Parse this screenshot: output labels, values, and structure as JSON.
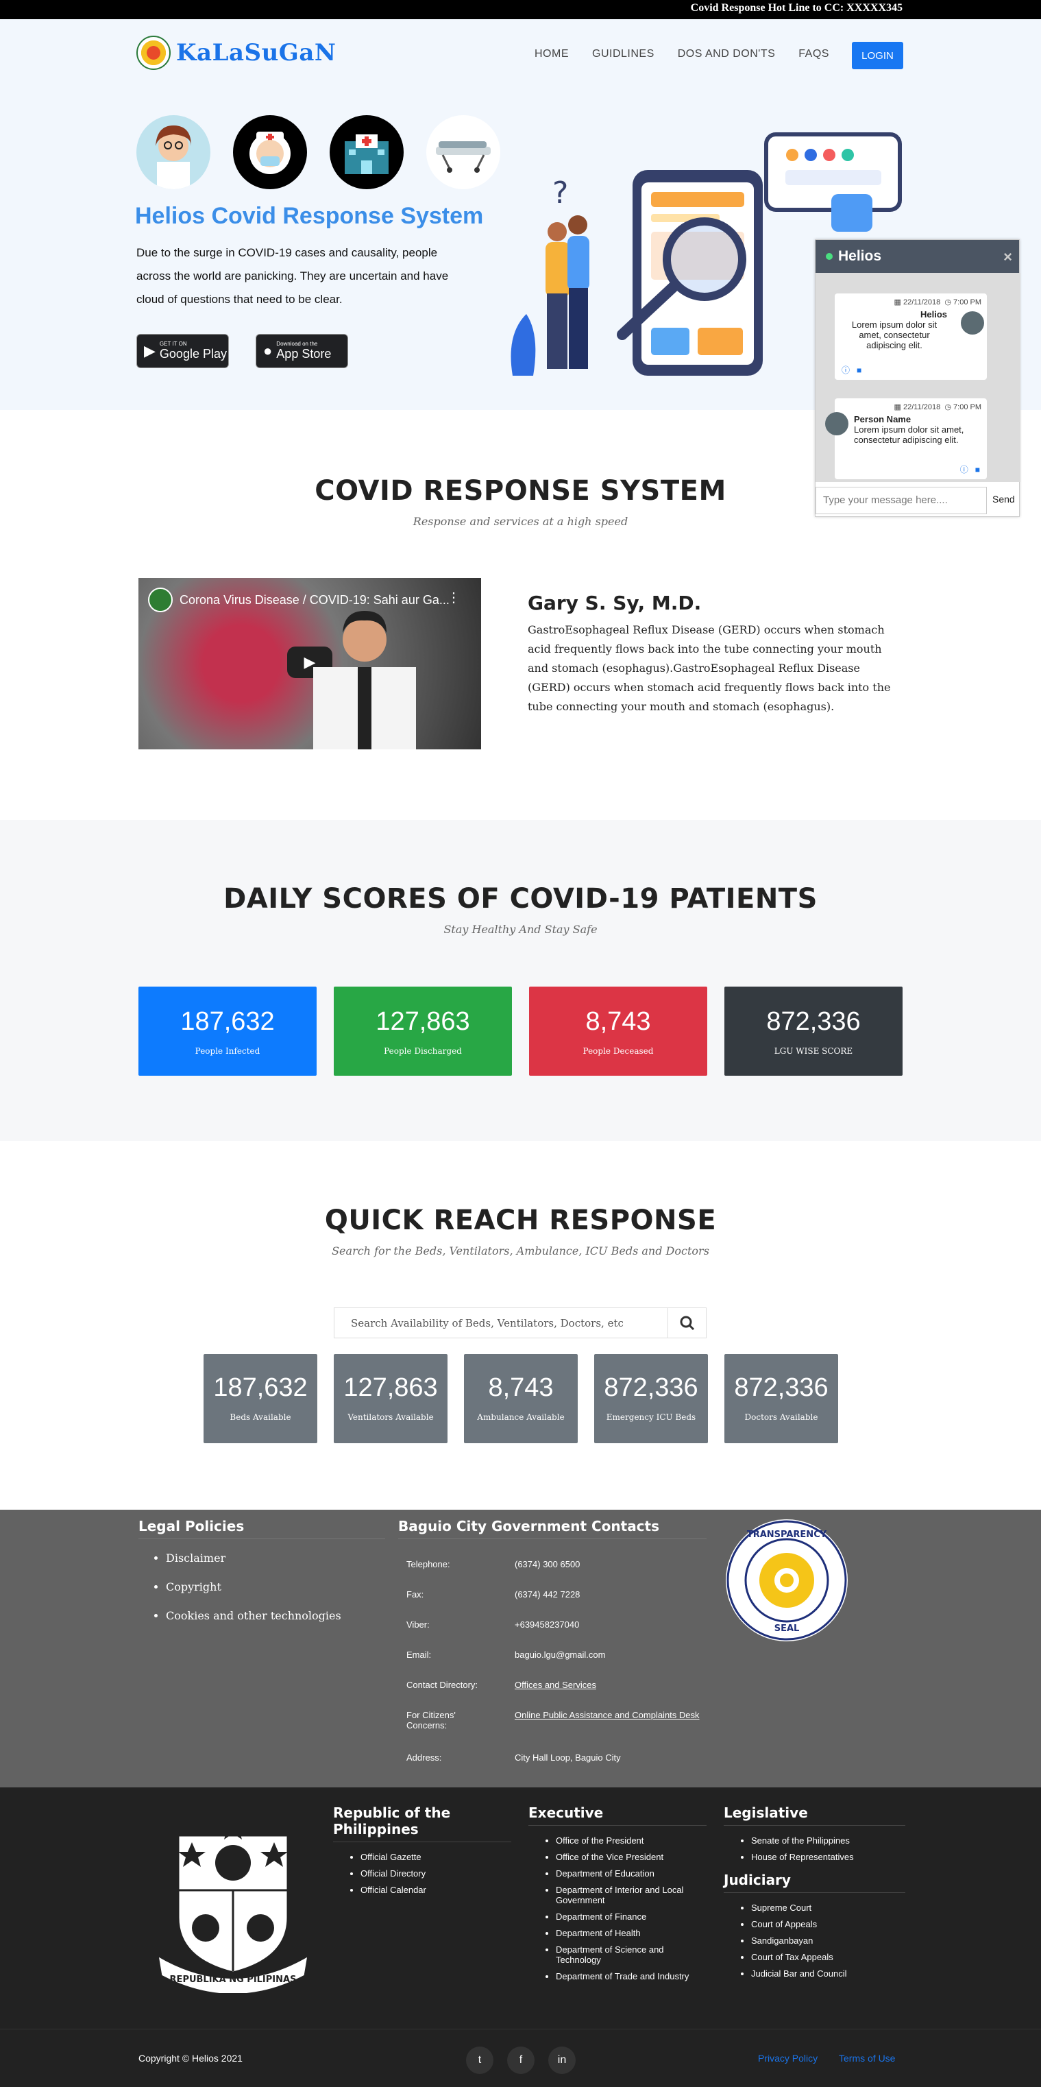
{
  "topbar": {
    "hotline": "Covid Response Hot Line to CC: XXXXX345"
  },
  "brand": {
    "name": "KaLaSuGaN"
  },
  "nav": {
    "items": [
      "HOME",
      "GUIDLINES",
      "DOS AND DON'TS",
      "FAQS"
    ],
    "login": "LOGIN"
  },
  "hero": {
    "title": "Helios Covid Response System",
    "description": "Due to the surge in COVID-19 cases and causality, people across the world are panicking. They are uncertain and have cloud of questions that need to be clear.",
    "google_small": "GET IT ON",
    "google_big": "Google Play",
    "apple_small": "Download on the",
    "apple_big": "App Store"
  },
  "chat": {
    "title": "Helios",
    "msg1": {
      "date": "22/11/2018",
      "time": "7:00 PM",
      "name": "Helios",
      "text": "Lorem ipsum dolor sit amet, consectetur adipiscing elit."
    },
    "msg2": {
      "date": "22/11/2018",
      "time": "7:00 PM",
      "name": "Person Name",
      "text": "Lorem ipsum dolor sit amet, consectetur adipiscing elit."
    },
    "placeholder": "Type your message here....",
    "send": "Send"
  },
  "covid_section": {
    "title": "COVID RESPONSE SYSTEM",
    "subtitle": "Response and services at a high speed",
    "video_title": "Corona Virus Disease / COVID-19: Sahi aur Ga...",
    "doctor_name": "Gary S. Sy, M.D.",
    "doctor_text": "GastroEsophageal Reflux Disease (GERD) occurs when stomach acid frequently flows back into the tube connecting your mouth and stomach (esophagus).GastroEsophageal Reflux Disease (GERD) occurs when stomach acid frequently flows back into the tube connecting your mouth and stomach (esophagus)."
  },
  "scores": {
    "title": "DAILY SCORES OF COVID-19 PATIENTS",
    "subtitle": "Stay Healthy And Stay Safe",
    "cards": [
      {
        "value": "187,632",
        "label": "People Infected",
        "color": "#0d7bfe"
      },
      {
        "value": "127,863",
        "label": "People Discharged",
        "color": "#28a745"
      },
      {
        "value": "8,743",
        "label": "People Deceased",
        "color": "#dc3545"
      },
      {
        "value": "872,336",
        "label": "LGU WISE SCORE",
        "color": "#343a40"
      }
    ]
  },
  "quick": {
    "title": "QUICK REACH RESPONSE",
    "subtitle": "Search for the Beds, Ventilators, Ambulance, ICU Beds and Doctors",
    "search_placeholder": "Search Availability of Beds, Ventilators, Doctors, etc",
    "items": [
      {
        "value": "187,632",
        "label": "Beds Available"
      },
      {
        "value": "127,863",
        "label": "Ventilators Available"
      },
      {
        "value": "8,743",
        "label": "Ambulance Available"
      },
      {
        "value": "872,336",
        "label": "Emergency ICU Beds"
      },
      {
        "value": "872,336",
        "label": "Doctors Available"
      }
    ]
  },
  "footer_legal": {
    "title": "Legal Policies",
    "items": [
      "Disclaimer",
      "Copyright",
      "Cookies and other technologies"
    ]
  },
  "footer_contacts": {
    "title": "Baguio City Government Contacts",
    "rows": [
      {
        "k": "Telephone:",
        "v": "(6374) 300 6500"
      },
      {
        "k": "Fax:",
        "v": "(6374) 442 7228"
      },
      {
        "k": "Viber:",
        "v": "+639458237040"
      },
      {
        "k": "Email:",
        "v": "baguio.lgu@gmail.com"
      },
      {
        "k": "Contact Directory:",
        "v": "Offices and Services"
      },
      {
        "k": "For Citizens' Concerns:",
        "v": "Online Public Assistance and Complaints Desk"
      },
      {
        "k": "Address:",
        "v": "City Hall Loop, Baguio City"
      }
    ]
  },
  "seal_text": "PHILIPPINE TRANSPARENCY SEAL",
  "coat_text": "REPUBLIKA NG PILIPINAS",
  "republic": {
    "title": "Republic of the Philippines",
    "items": [
      "Official Gazette",
      "Official Directory",
      "Official Calendar"
    ]
  },
  "executive": {
    "title": "Executive",
    "items": [
      "Office of the President",
      "Office of the Vice President",
      "Department of Education",
      "Department of Interior and Local Government",
      "Department of Finance",
      "Department of Health",
      "Department of Science and Technology",
      "Department of Trade and Industry"
    ]
  },
  "legislative": {
    "title": "Legislative",
    "items": [
      "Senate of the Philippines",
      "House of Representatives"
    ]
  },
  "judiciary": {
    "title": "Judiciary",
    "items": [
      "Supreme Court",
      "Court of Appeals",
      "Sandiganbayan",
      "Court of Tax Appeals",
      "Judicial Bar and Council"
    ]
  },
  "bottom": {
    "copyright": "Copyright © Helios 2021",
    "privacy": "Privacy Policy",
    "terms": "Terms of Use"
  }
}
